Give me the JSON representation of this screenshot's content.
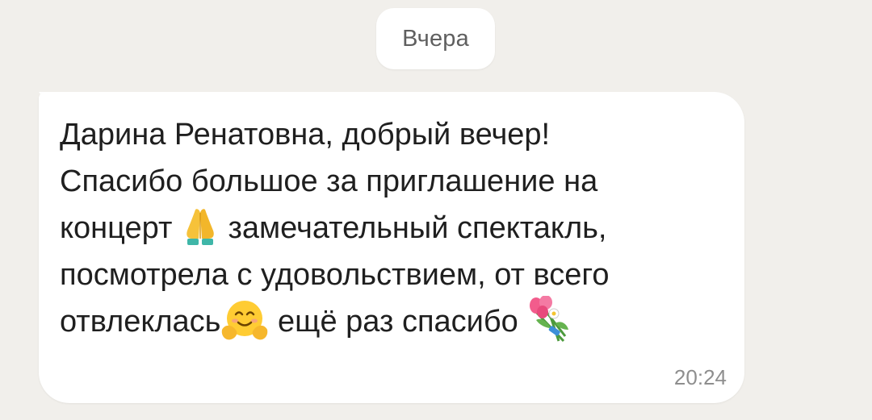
{
  "chat": {
    "date_label": "Вчера",
    "message": {
      "lines": [
        {
          "text": "Дарина Ренатовна, добрый вечер!"
        },
        {
          "text": "Спасибо большое за приглашение на"
        },
        {
          "before": "концерт ",
          "emoji": "folded-hands-emoji",
          "after": " замечательный спектакль,"
        },
        {
          "text": "посмотрела с удовольствием, от всего"
        },
        {
          "before": "отвлеклась",
          "emoji": "hugging-face-emoji",
          "after": " ещё раз спасибо ",
          "emoji2": "bouquet-emoji"
        }
      ],
      "time": "20:24"
    }
  },
  "colors": {
    "background": "#f1efeb",
    "bubble": "#ffffff",
    "text": "#1f1f1f",
    "meta_text": "#8e8e8e"
  }
}
